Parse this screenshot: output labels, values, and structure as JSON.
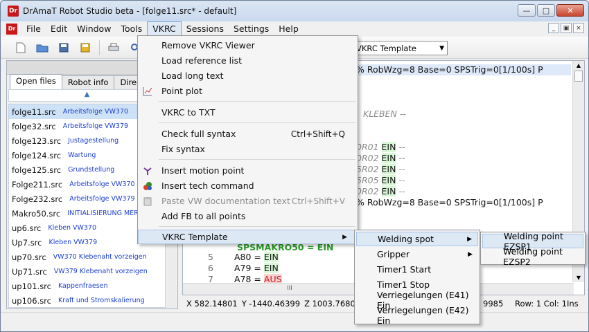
{
  "window": {
    "title": "DrAmaT Robot Studio beta - [folge11.src* - default]",
    "app_icon": "Dr",
    "min_label": "—",
    "max_label": "□",
    "close_label": "✕"
  },
  "menubar": {
    "items": [
      "File",
      "Edit",
      "Window",
      "Tools",
      "VKRC",
      "Sessions",
      "Settings",
      "Help"
    ],
    "active": "VKRC",
    "mdi_min": "_",
    "mdi_restore": "▣",
    "mdi_close": "×"
  },
  "toolbar": {
    "combo_value": "VKRC Template",
    "combo_arrow": "▼"
  },
  "left_panel": {
    "tabs": [
      "Open files",
      "Robot info",
      "Directo"
    ],
    "sort_indicator": "▲",
    "files": [
      {
        "name": "folge11.src",
        "desc": "Arbeitsfolge VW370"
      },
      {
        "name": "folge32.src",
        "desc": "Arbeitsfolge VW379"
      },
      {
        "name": "folge123.src",
        "desc": "Justagestellung"
      },
      {
        "name": "folge124.src",
        "desc": "Wartung"
      },
      {
        "name": "folge125.src",
        "desc": "Grundstellung"
      },
      {
        "name": "Folge211.src",
        "desc": "Arbeitsfolge VW370"
      },
      {
        "name": "Folge232.src",
        "desc": "Arbeitsfolge VW379"
      },
      {
        "name": "Makro50.src",
        "desc": "INITIALISIERUNG MERK"
      },
      {
        "name": "up6.src",
        "desc": "Kleben VW370"
      },
      {
        "name": "Up7.src",
        "desc": "Kleben VW379"
      },
      {
        "name": "up70.src",
        "desc": "VW370 Klebenaht vorzeigen"
      },
      {
        "name": "Up71.src",
        "desc": "VW379 Klebenaht vorzeigen"
      },
      {
        "name": "up101.src",
        "desc": "Kappenfraesen"
      },
      {
        "name": "up106.src",
        "desc": "Kraft und Stromskalierung"
      }
    ]
  },
  "editor": {
    "lines": {
      "l1": "% RobWzg=8 Base=0 SPSTrig=0[1/100s] P",
      "l2": "KLEBEN --",
      "l3a": "0R01",
      "l3b": "EIN",
      "l3c": "--",
      "l4a": "0R02",
      "l4b": "EIN",
      "l4c": "--",
      "l5a": "5R02",
      "l5b": "EIN",
      "l5c": "--",
      "l6a": "5R05",
      "l6b": "EIN",
      "l6c": "--",
      "l7a": "0R02",
      "l7b": "EIN",
      "l7c": "--",
      "l8": "% RobWzg=8 Base=0 SPSTrig=0[1/100s] P",
      "l9": "SPSMAKRO50 = EIN",
      "n5": "5",
      "t5a": "A80 =",
      "t5b": "EIN",
      "n6": "6",
      "t6a": "A79 =",
      "t6b": "EIN",
      "n7": "7",
      "t7a": "A78 =",
      "t7b": "AUS"
    },
    "scroll_up": "▲",
    "scroll_down": "▼",
    "hscroll_grip": "III"
  },
  "statusbar": {
    "x": "X 582.14801",
    "y": "Y -1440.46399",
    "z": "Z 1003.76801",
    "a": "A -",
    "right": "9985",
    "pos": "Row: 1 Col: 1",
    "mode": "Ins"
  },
  "vkrc_menu": {
    "items": [
      {
        "label": "Remove VKRC Viewer",
        "shortcut": "",
        "icon": "",
        "disabled": false
      },
      {
        "label": "Load reference list",
        "shortcut": "",
        "icon": "",
        "disabled": false
      },
      {
        "label": "Load long text",
        "shortcut": "",
        "icon": "",
        "disabled": false
      },
      {
        "label": "Point plot",
        "shortcut": "",
        "icon": "plot-icon",
        "disabled": false
      },
      {
        "label": "VKRC to TXT",
        "shortcut": "",
        "icon": "",
        "disabled": false
      },
      {
        "label": "Check full syntax",
        "shortcut": "Ctrl+Shift+Q",
        "icon": "",
        "disabled": false
      },
      {
        "label": "Fix syntax",
        "shortcut": "",
        "icon": "",
        "disabled": false
      },
      {
        "label": "Insert motion point",
        "shortcut": "",
        "icon": "motion-icon",
        "disabled": false
      },
      {
        "label": "Insert tech command",
        "shortcut": "",
        "icon": "tech-icon",
        "disabled": false
      },
      {
        "label": "Paste VW documentation text",
        "shortcut": "Ctrl+Shift+V",
        "icon": "paste-icon",
        "disabled": true
      },
      {
        "label": "Add FB to all points",
        "shortcut": "",
        "icon": "",
        "disabled": false
      },
      {
        "label": "VKRC Template",
        "shortcut": "",
        "icon": "",
        "disabled": false,
        "submenu": true
      }
    ]
  },
  "template_submenu": {
    "items": [
      {
        "label": "Welding spot",
        "submenu": true
      },
      {
        "label": "Gripper",
        "submenu": true
      },
      {
        "label": "Timer1 Start"
      },
      {
        "label": "Timer1 Stop"
      },
      {
        "label": "Verriegelungen (E41) Ein"
      },
      {
        "label": "Verriegelungen (E42) Ein"
      }
    ]
  },
  "welding_submenu": {
    "items": [
      "Welding point EZSP1",
      "Welding point EZSP2"
    ]
  }
}
